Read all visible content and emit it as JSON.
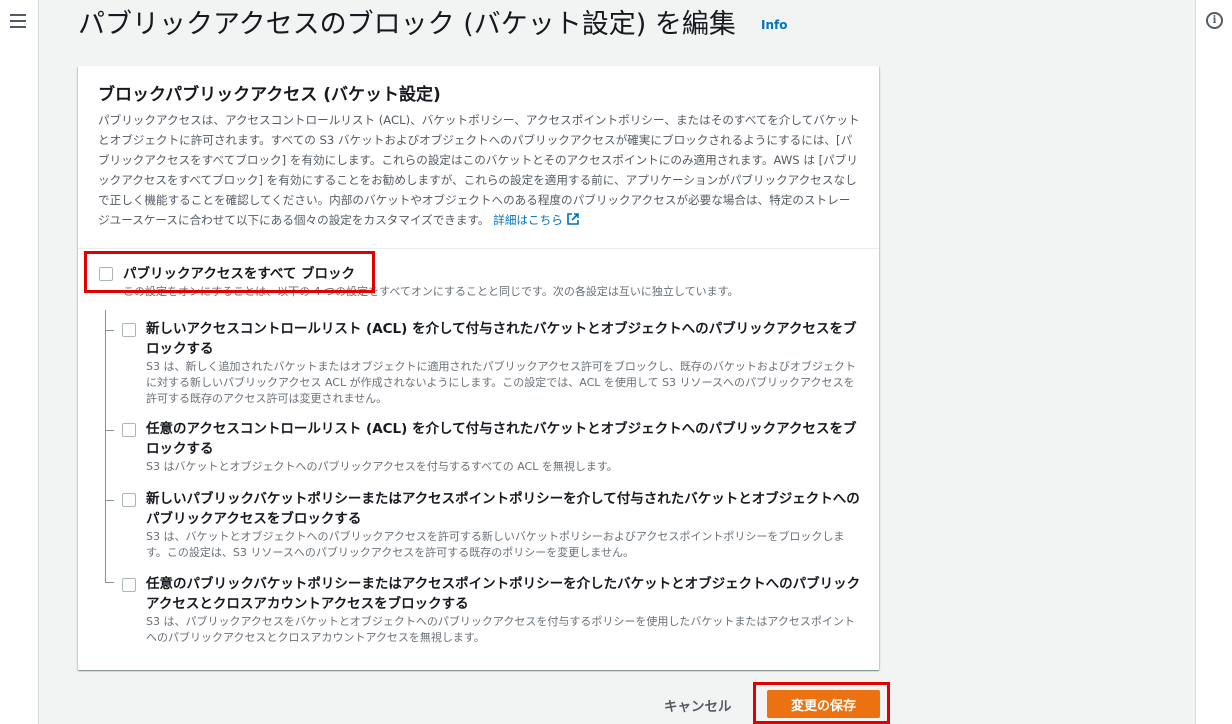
{
  "page": {
    "title": "パブリックアクセスのブロック (バケット設定) を編集",
    "info_link": "Info"
  },
  "panel": {
    "title": "ブロックパブリックアクセス (バケット設定)",
    "description": "パブリックアクセスは、アクセスコントロールリスト (ACL)、バケットポリシー、アクセスポイントポリシー、またはそのすべてを介してバケットとオブジェクトに許可されます。すべての S3 バケットおよびオブジェクトへのパブリックアクセスが確実にブロックされるようにするには、[パブリックアクセスをすべてブロック] を有効にします。これらの設定はこのバケットとそのアクセスポイントにのみ適用されます。AWS は [パブリックアクセスをすべてブロック] を有効にすることをお勧めしますが、これらの設定を適用する前に、アプリケーションがパブリックアクセスなしで正しく機能することを確認してください。内部のバケットやオブジェクトへのある程度のパブリックアクセスが必要な場合は、特定のストレージユースケースに合わせて以下にある個々の設定をカスタマイズできます。",
    "detail_link": "詳細はこちら"
  },
  "block_all": {
    "label": "パブリックアクセスをすべて ブロック",
    "description": "この設定をオンにすることは、以下の 4 つの設定をすべてオンにすることと同じです。次の各設定は互いに独立しています。",
    "checked": false
  },
  "options": [
    {
      "title": "新しいアクセスコントロールリスト (ACL) を介して付与されたバケットとオブジェクトへのパブリックアクセスをブロックする",
      "description": "S3 は、新しく追加されたバケットまたはオブジェクトに適用されたパブリックアクセス許可をブロックし、既存のバケットおよびオブジェクトに対する新しいパブリックアクセス ACL が作成されないようにします。この設定では、ACL を使用して S3 リソースへのパブリックアクセスを許可する既存のアクセス許可は変更されません。",
      "checked": false
    },
    {
      "title": "任意のアクセスコントロールリスト (ACL) を介して付与されたバケットとオブジェクトへのパブリックアクセスをブロックする",
      "description": "S3 はバケットとオブジェクトへのパブリックアクセスを付与するすべての ACL を無視します。",
      "checked": false
    },
    {
      "title": "新しいパブリックバケットポリシーまたはアクセスポイントポリシーを介して付与されたバケットとオブジェクトへのパブリックアクセスをブロックする",
      "description": "S3 は、バケットとオブジェクトへのパブリックアクセスを許可する新しいバケットポリシーおよびアクセスポイントポリシーをブロックします。この設定は、S3 リソースへのパブリックアクセスを許可する既存のポリシーを変更しません。",
      "checked": false
    },
    {
      "title": "任意のパブリックバケットポリシーまたはアクセスポイントポリシーを介したバケットとオブジェクトへのパブリックアクセスとクロスアカウントアクセスをブロックする",
      "description": "S3 は、パブリックアクセスをバケットとオブジェクトへのパブリックアクセスを付与するポリシーを使用したバケットまたはアクセスポイントへのパブリックアクセスとクロスアカウントアクセスを無視します。",
      "checked": false
    }
  ],
  "footer": {
    "cancel_label": "キャンセル",
    "save_label": "変更の保存"
  },
  "colors": {
    "primary_button": "#ec7211",
    "link": "#0073bb",
    "highlight": "#e00000"
  }
}
